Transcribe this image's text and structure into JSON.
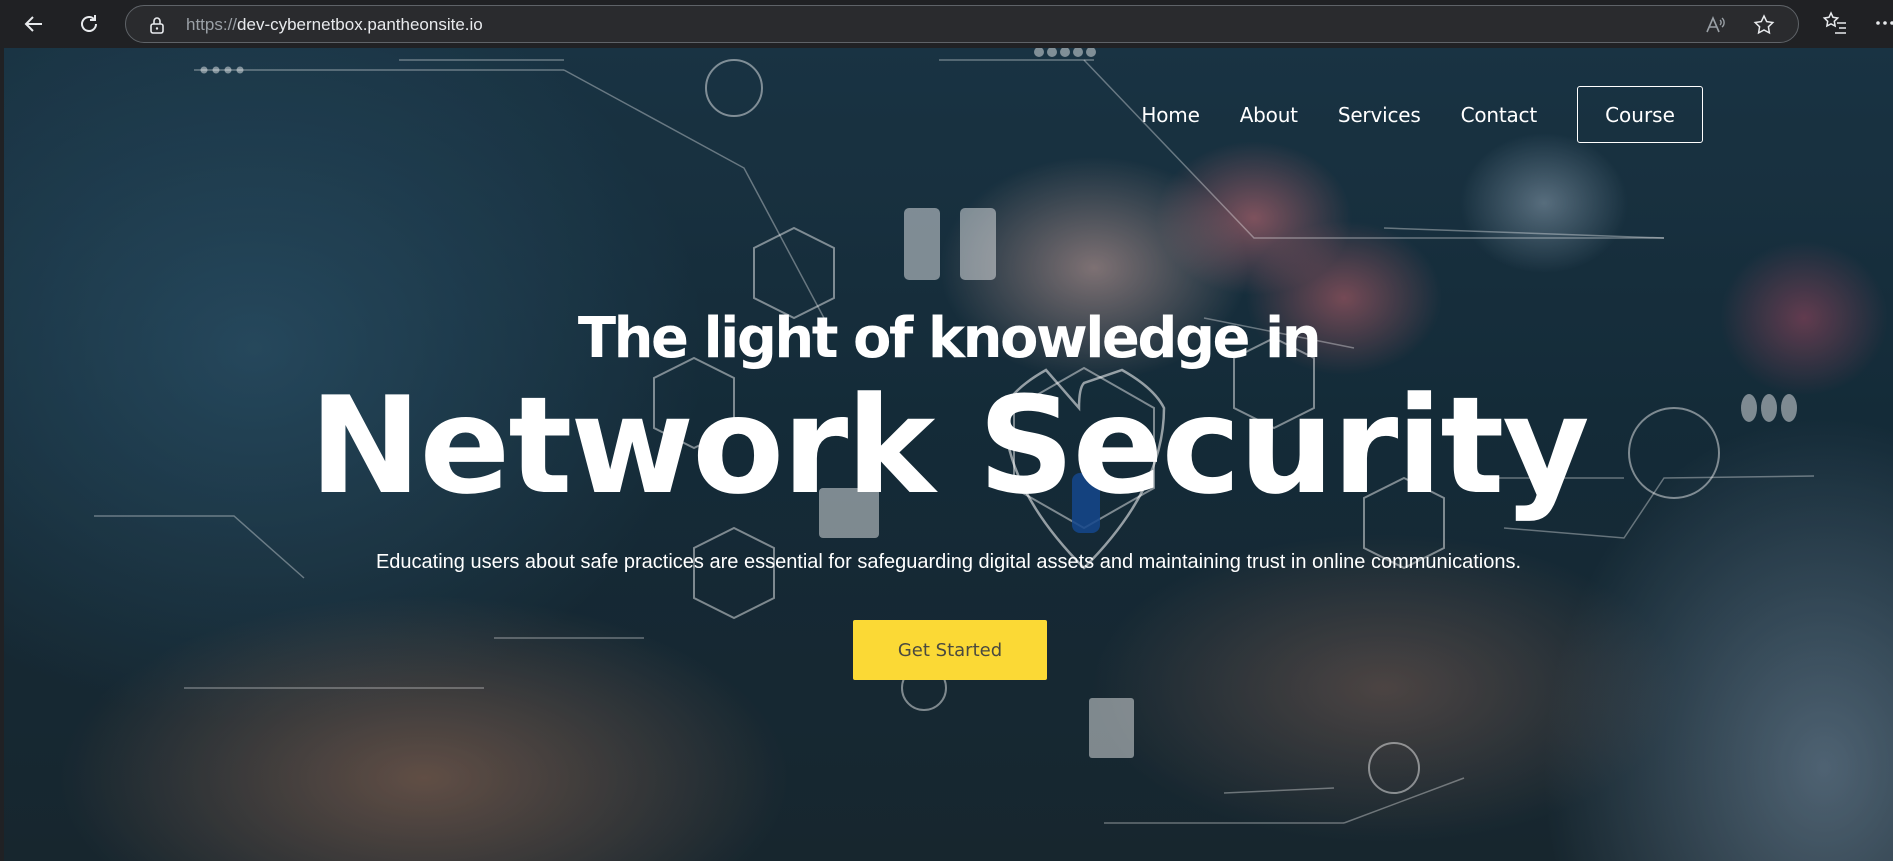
{
  "browser": {
    "url_protocol": "https://",
    "url_host": "dev-cybernetbox.pantheonsite.io",
    "icons": [
      "back-icon",
      "refresh-icon",
      "lock-icon",
      "read-aloud-icon",
      "favorite-star-icon",
      "favorites-list-icon",
      "more-icon"
    ]
  },
  "nav": {
    "items": [
      {
        "label": "Home"
      },
      {
        "label": "About"
      },
      {
        "label": "Services"
      },
      {
        "label": "Contact"
      }
    ],
    "course_label": "Course"
  },
  "hero": {
    "heading_line1": "The light of knowledge in",
    "heading_line2": "Network Security",
    "subtitle": "Educating users about safe practices are essential for safeguarding digital assets and maintaining trust in online communications.",
    "cta_label": "Get Started"
  },
  "colors": {
    "cta_background": "#fbd935",
    "text": "#ffffff",
    "chrome_background": "#202124"
  }
}
